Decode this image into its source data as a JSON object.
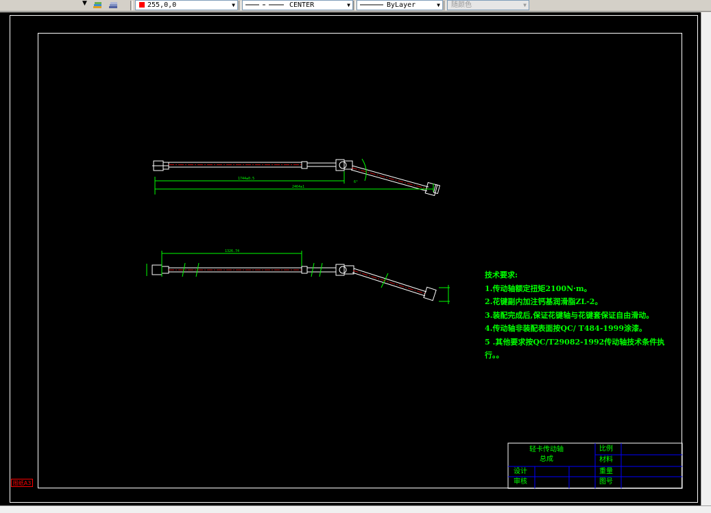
{
  "toolbar": {
    "color_value": "255,0,0",
    "color_swatch": "#ff0000",
    "linetype_value": "CENTER",
    "lineweight_value": "ByLayer",
    "plotstyle_value": "随颜色",
    "layer_icons": [
      "layer-states-icon",
      "layer-previous-icon"
    ]
  },
  "drawing": {
    "tech_requirements": [
      "技术要求:",
      "1.传动轴额定扭矩2100N·m。",
      "2.花键副内加注钙基润滑脂ZL-2。",
      "3.装配完成后,保证花键轴与花键套保证自由滑动。",
      "4.传动轴非装配表面按QC/ T484-1999涂漆。",
      "5 .其他要求按QC/T29082-1992传动轴技术条件执",
      "行。。"
    ],
    "title_block": {
      "name_line1": "轻卡传动轴",
      "name_line2": "总成",
      "scale_label": "比例",
      "material_label": "材料",
      "design_label": "设计",
      "review_label": "审核",
      "weight_label": "重量",
      "drawing_no_label": "图号"
    },
    "corner_label": "图纸A3",
    "dimensions": {
      "top_length_1": "1744±0.5",
      "top_length_2": "2464±1",
      "top_angle": "6°",
      "bottom_length": "1326.74"
    }
  }
}
